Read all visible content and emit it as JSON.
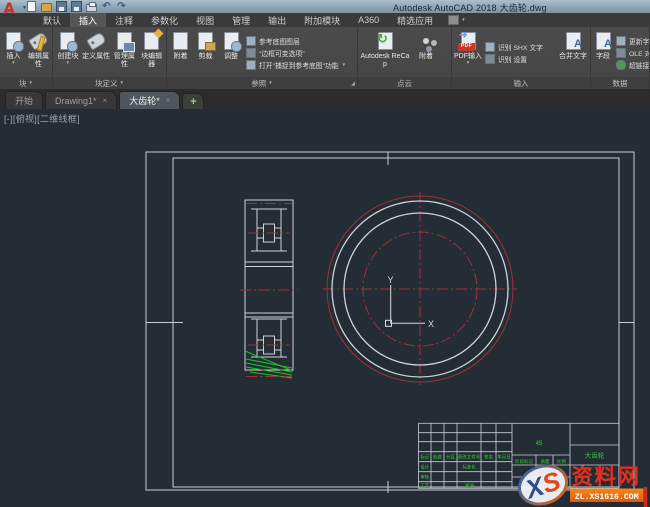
{
  "window": {
    "title": "Autodesk AutoCAD 2018   大齿轮.dwg",
    "logo": "A"
  },
  "ribbon": {
    "tabs": [
      {
        "label": "默认"
      },
      {
        "label": "插入",
        "active": true
      },
      {
        "label": "注释"
      },
      {
        "label": "参数化"
      },
      {
        "label": "视图"
      },
      {
        "label": "管理"
      },
      {
        "label": "输出"
      },
      {
        "label": "附加模块"
      },
      {
        "label": "A360"
      },
      {
        "label": "精选应用"
      }
    ],
    "panels": {
      "block": {
        "label": "块",
        "insert": "插入",
        "edit_attr": "编辑属性"
      },
      "block_def": {
        "label": "块定义",
        "create": "创建块",
        "def_attr": "定义属性",
        "manage_attr": "管理属性",
        "editor": "块编辑器"
      },
      "reference": {
        "label": "参照",
        "attach": "附着",
        "clip": "剪裁",
        "adjust": "调整",
        "rows": [
          "参考底图图层",
          "\"边框可变选项\"",
          "打开\"捕捉到参考底图\"功能"
        ]
      },
      "pointcloud": {
        "label": "点云",
        "recap": "Autodesk ReCap",
        "attach": "附着"
      },
      "import": {
        "label": "输入",
        "pdf": "PDF输入",
        "rows": [
          "识别 SHX 文字",
          "识别 设置"
        ],
        "combine": "合并文字"
      },
      "data": {
        "label": "数据",
        "field": "字段",
        "rows": [
          "更新字段",
          "OLE 对象",
          "超链接"
        ]
      }
    }
  },
  "file_tabs": {
    "start": "开始",
    "drawing1": "Drawing1*",
    "gear": "大齿轮*",
    "close": "×",
    "plus": "+"
  },
  "viewport_control": "[-][俯视][二维线框]",
  "drawing": {
    "ucs": {
      "x_label": "X",
      "y_label": "Y"
    },
    "titleblock": {
      "revision_headers": [
        "标记",
        "处数",
        "分区",
        "更改文件号",
        "签名",
        "年月日"
      ],
      "row_design": "设计",
      "row_standard": "标准化",
      "row_check": "审核",
      "row_process": "工艺",
      "row_approve": "批准",
      "material": "45",
      "stage": "阶段标记",
      "mass": "质量",
      "scale": "比例",
      "part_name": "大齿轮"
    },
    "watermark": {
      "logo_x": "X",
      "logo_s": "S",
      "name": "资料网",
      "url": "ZL.XS1616.COM"
    }
  },
  "colors": {
    "canvas_bg": "#242c36",
    "line_white": "#ccd2d8",
    "line_red": "#a23236",
    "line_green": "#1ec41e",
    "titleblock_text_green": "#2fd32f",
    "watermark_red": "#e5301d",
    "watermark_orange": "#ee6f12"
  }
}
